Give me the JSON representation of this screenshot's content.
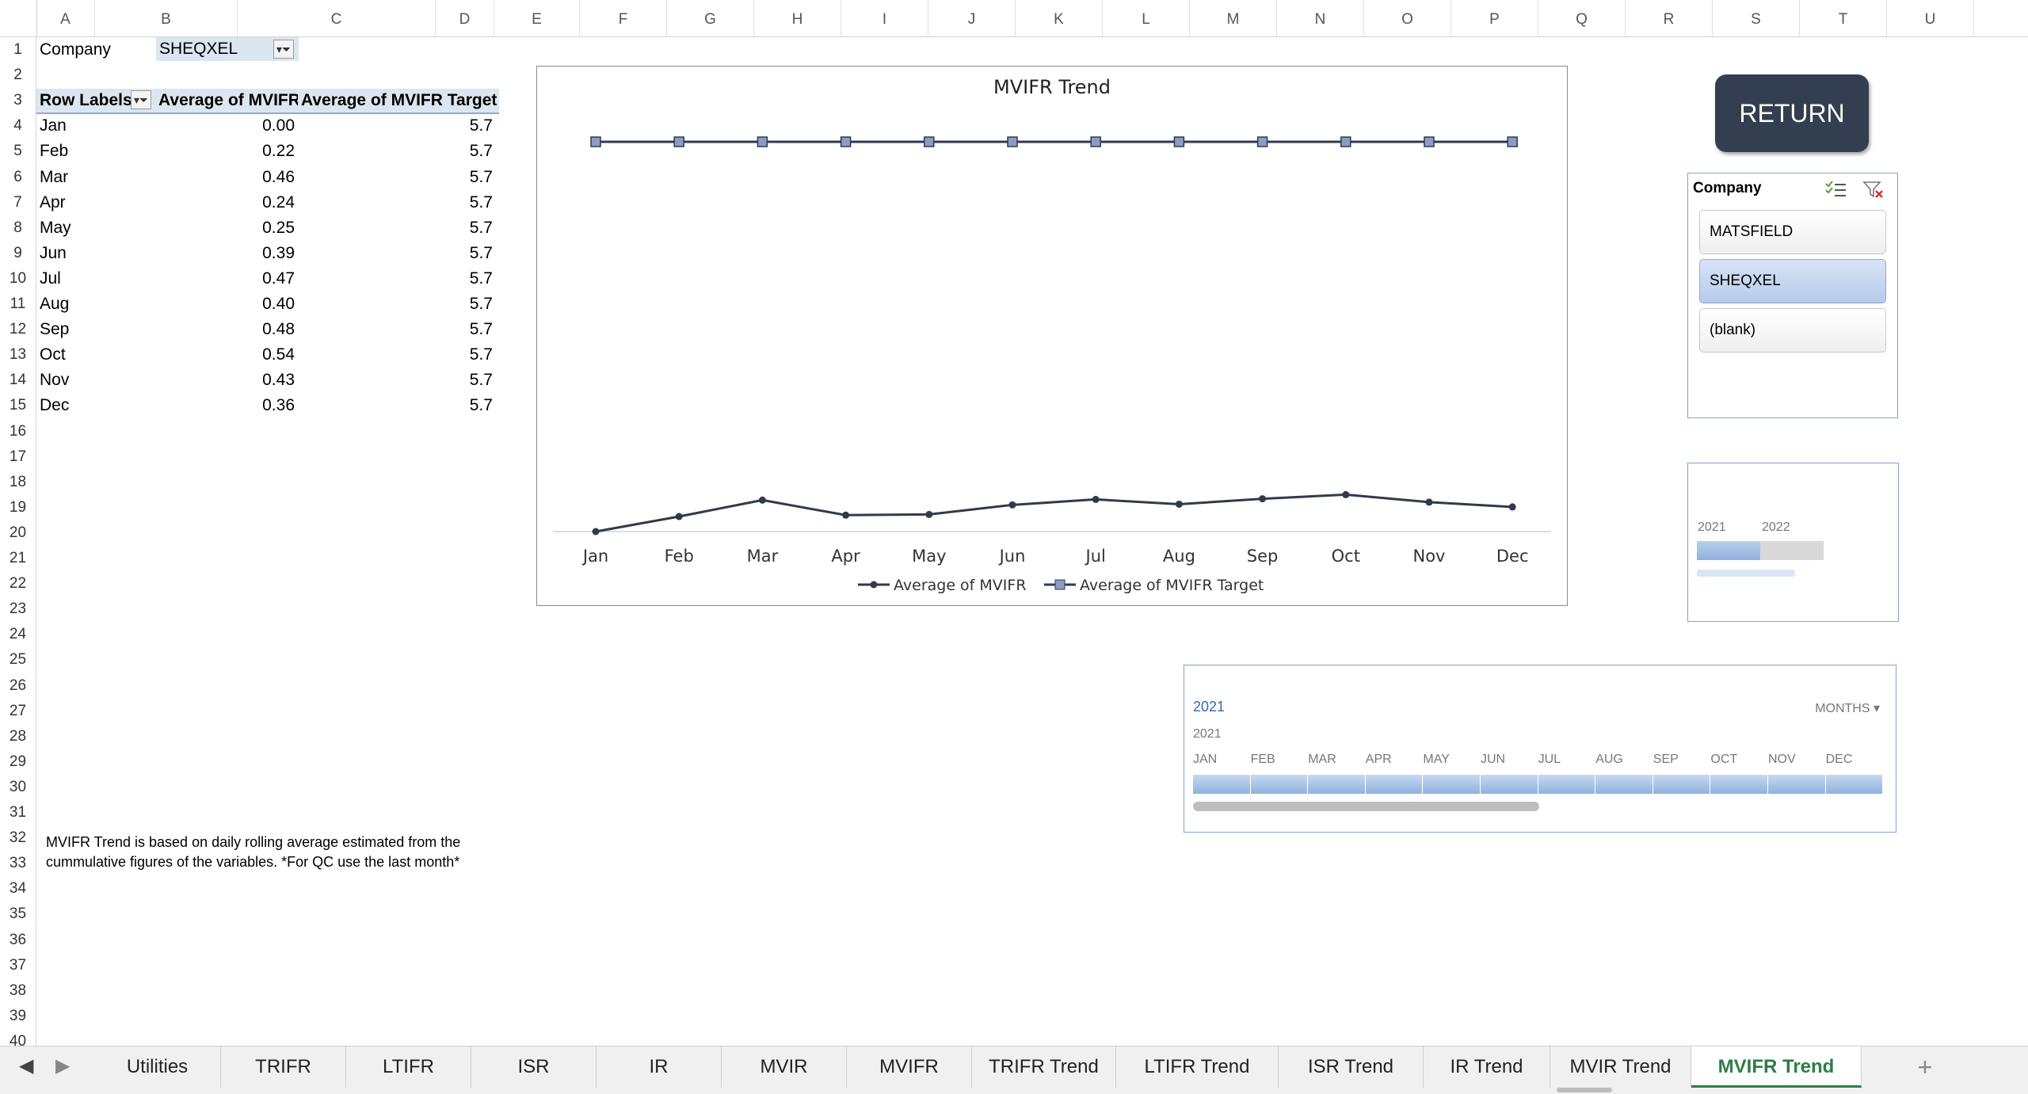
{
  "columns": [
    "A",
    "B",
    "C",
    "D",
    "E",
    "F",
    "G",
    "H",
    "I",
    "J",
    "K",
    "L",
    "M",
    "N",
    "O",
    "P",
    "Q",
    "R",
    "S",
    "T",
    "U"
  ],
  "rows": [
    "1",
    "2",
    "3",
    "4",
    "5",
    "6",
    "7",
    "8",
    "9",
    "10",
    "11",
    "12",
    "13",
    "14",
    "15",
    "16",
    "17",
    "18",
    "19",
    "20",
    "21",
    "22",
    "23",
    "24",
    "25",
    "26",
    "27",
    "28",
    "29",
    "30",
    "31",
    "32",
    "33",
    "34",
    "35",
    "36",
    "37",
    "38",
    "39",
    "40"
  ],
  "filter": {
    "label": "Company",
    "value": "SHEQXEL"
  },
  "pivot": {
    "headers": [
      "Row Labels",
      "Average of MVIFR",
      "Average of MVIFR Target"
    ],
    "rows": [
      {
        "month": "Jan",
        "mvifr": "0.00",
        "target": "5.7"
      },
      {
        "month": "Feb",
        "mvifr": "0.22",
        "target": "5.7"
      },
      {
        "month": "Mar",
        "mvifr": "0.46",
        "target": "5.7"
      },
      {
        "month": "Apr",
        "mvifr": "0.24",
        "target": "5.7"
      },
      {
        "month": "May",
        "mvifr": "0.25",
        "target": "5.7"
      },
      {
        "month": "Jun",
        "mvifr": "0.39",
        "target": "5.7"
      },
      {
        "month": "Jul",
        "mvifr": "0.47",
        "target": "5.7"
      },
      {
        "month": "Aug",
        "mvifr": "0.40",
        "target": "5.7"
      },
      {
        "month": "Sep",
        "mvifr": "0.48",
        "target": "5.7"
      },
      {
        "month": "Oct",
        "mvifr": "0.54",
        "target": "5.7"
      },
      {
        "month": "Nov",
        "mvifr": "0.43",
        "target": "5.7"
      },
      {
        "month": "Dec",
        "mvifr": "0.36",
        "target": "5.7"
      }
    ]
  },
  "note": {
    "line1": "MVIFR Trend is based on daily rolling average estimated from the",
    "line2": "cummulative figures of the variables. *For QC use the last month*"
  },
  "chart_data": {
    "type": "line",
    "title": "MVIFR Trend",
    "categories": [
      "Jan",
      "Feb",
      "Mar",
      "Apr",
      "May",
      "Jun",
      "Jul",
      "Aug",
      "Sep",
      "Oct",
      "Nov",
      "Dec"
    ],
    "series": [
      {
        "name": "Average of MVIFR",
        "values": [
          0.0,
          0.22,
          0.46,
          0.24,
          0.25,
          0.39,
          0.47,
          0.4,
          0.48,
          0.54,
          0.43,
          0.36
        ],
        "color": "#2f3b4c",
        "marker": "circle"
      },
      {
        "name": "Average of MVIFR Target",
        "values": [
          5.7,
          5.7,
          5.7,
          5.7,
          5.7,
          5.7,
          5.7,
          5.7,
          5.7,
          5.7,
          5.7,
          5.7
        ],
        "color": "#2f3b4c",
        "marker": "square",
        "marker_fill": "#8b9dc3"
      }
    ],
    "ylim": [
      0,
      5.7
    ],
    "grid": false,
    "legend": "bottom"
  },
  "return_button": {
    "label": "RETURN",
    "color": "#333f50"
  },
  "company_slicer": {
    "title": "Company",
    "items": [
      {
        "label": "MATSFIELD",
        "selected": false
      },
      {
        "label": "SHEQXEL",
        "selected": true
      },
      {
        "label": "(blank)",
        "selected": false
      }
    ],
    "icons": [
      "multi-select-icon",
      "clear-filter-icon"
    ]
  },
  "year_timeline": {
    "years": [
      "2021",
      "2022"
    ]
  },
  "month_timeline": {
    "selected_year": "2021",
    "level": "MONTHS",
    "year_label": "2021",
    "months": [
      "JAN",
      "FEB",
      "MAR",
      "APR",
      "MAY",
      "JUN",
      "JUL",
      "AUG",
      "SEP",
      "OCT",
      "NOV",
      "DEC"
    ]
  },
  "tabs": [
    {
      "label": "Utilities",
      "active": false
    },
    {
      "label": "TRIFR",
      "active": false
    },
    {
      "label": "LTIFR",
      "active": false
    },
    {
      "label": "ISR",
      "active": false
    },
    {
      "label": "IR",
      "active": false
    },
    {
      "label": "MVIR",
      "active": false
    },
    {
      "label": "MVIFR",
      "active": false
    },
    {
      "label": "TRIFR Trend",
      "active": false
    },
    {
      "label": "LTIFR Trend",
      "active": false
    },
    {
      "label": "ISR Trend",
      "active": false
    },
    {
      "label": "IR Trend",
      "active": false
    },
    {
      "label": "MVIR Trend",
      "active": false
    },
    {
      "label": "MVIFR Trend",
      "active": true
    }
  ],
  "add_sheet_label": "+"
}
